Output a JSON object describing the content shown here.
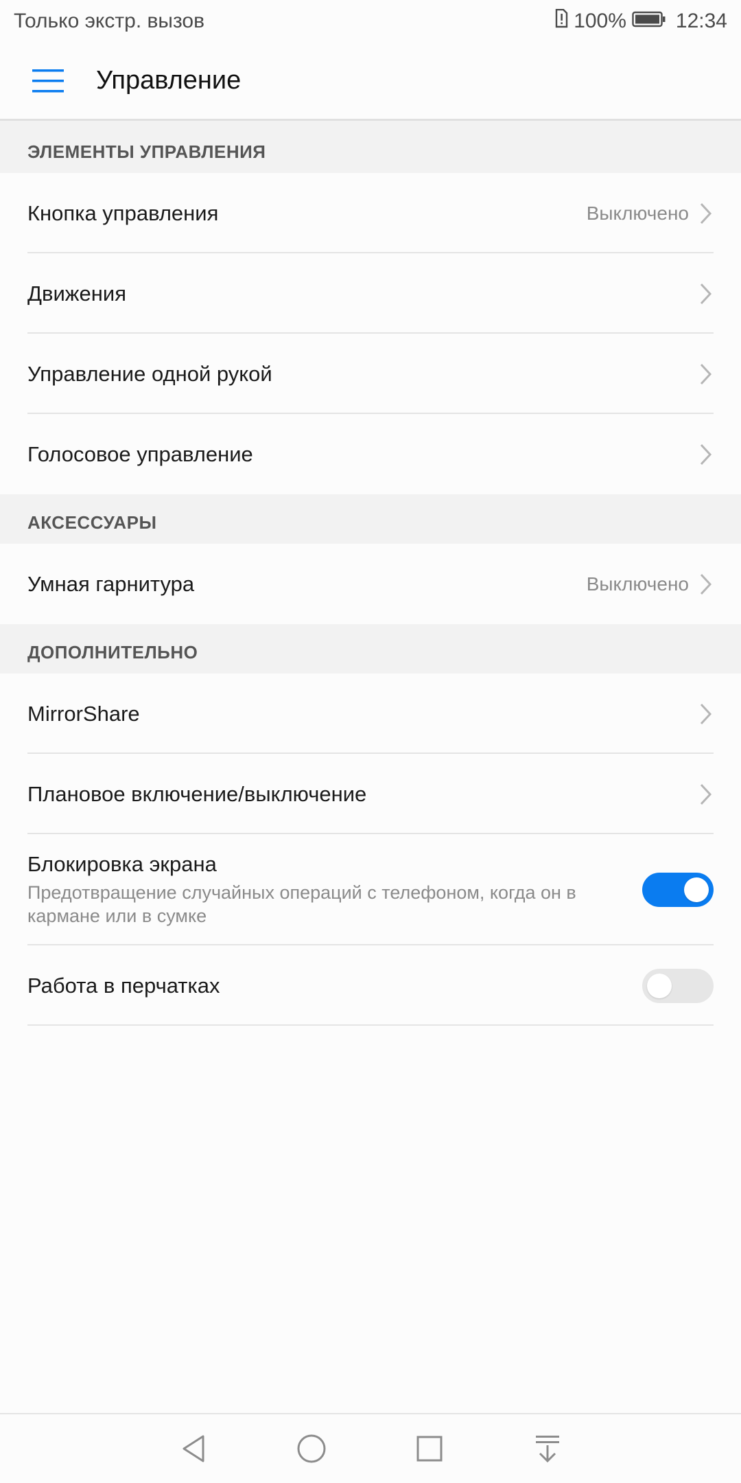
{
  "status_bar": {
    "left_text": "Только экстр. вызов",
    "battery_percent": "100%",
    "time": "12:34",
    "icons": [
      "sim-alert-icon",
      "battery-icon"
    ]
  },
  "app_bar": {
    "title": "Управление",
    "menu_icon": "hamburger-menu-icon"
  },
  "sections": {
    "controls": {
      "header": "ЭЛЕМЕНТЫ УПРАВЛЕНИЯ",
      "items": [
        {
          "label": "Кнопка управления",
          "value": "Выключено"
        },
        {
          "label": "Движения"
        },
        {
          "label": "Управление одной рукой"
        },
        {
          "label": "Голосовое управление"
        }
      ]
    },
    "accessories": {
      "header": "АКСЕССУАРЫ",
      "items": [
        {
          "label": "Умная гарнитура",
          "value": "Выключено"
        }
      ]
    },
    "additional": {
      "header": "ДОПОЛНИТЕЛЬНО",
      "items": [
        {
          "label": "MirrorShare"
        },
        {
          "label": "Плановое включение/выключение"
        },
        {
          "label": "Блокировка экрана",
          "subtitle": "Предотвращение случайных операций с телефоном, когда он в кармане или в сумке",
          "toggle": true
        },
        {
          "label": "Работа в перчатках",
          "toggle": false
        }
      ]
    }
  },
  "colors": {
    "accent": "#0a7cf0",
    "toggle_off": "#e6e6e6",
    "section_bg": "#f2f2f2"
  },
  "nav_bar": {
    "icons": [
      "back-icon",
      "home-icon",
      "recents-icon",
      "notifications-pull-icon"
    ]
  }
}
